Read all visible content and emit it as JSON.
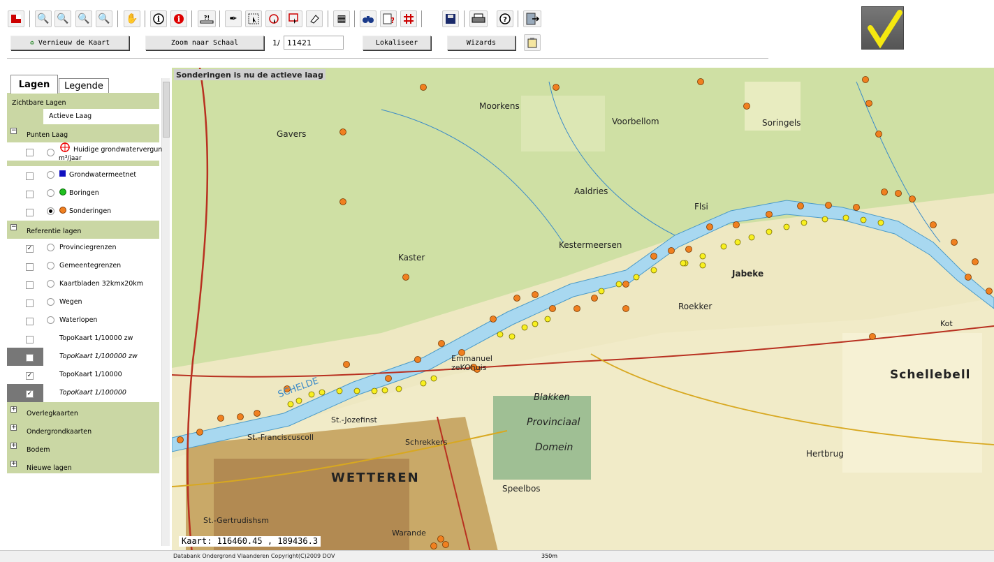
{
  "toolbar": {
    "icons": [
      "map-icon",
      "zoom-in-icon",
      "zoom-out-icon",
      "zoom-extent-icon",
      "zoom-select-icon",
      "pan-hand-icon",
      "info-icon",
      "info-red-icon",
      "measure-icon",
      "select-tool-icon",
      "select-arrow-icon",
      "select-circle-icon",
      "select-box-icon",
      "eraser-icon",
      "calculator-icon",
      "binoculars-icon",
      "query-icon",
      "grid-icon",
      "save-icon",
      "print-icon",
      "help-icon",
      "exit-icon"
    ],
    "refresh_label": "Vernieuw de Kaart",
    "zoom_scale_label": "Zoom naar Schaal",
    "scale_prefix": "1/",
    "scale_value": "11421",
    "locate_label": "Lokaliseer",
    "wizards_label": "Wizards"
  },
  "sidebar": {
    "tabs": [
      "Lagen",
      "Legende"
    ],
    "visible_layers_title": "Zichtbare Lagen",
    "active_layer_label": "Actieve Laag",
    "groups": {
      "points": "Punten Laag",
      "reference": "Referentie lagen",
      "overlay": "Overlegkaarten",
      "subsurface": "Ondergrondkaarten",
      "soil": "Bodem",
      "new": "Nieuwe lagen"
    },
    "point_layers": [
      {
        "label": "Huidige grondwatervergun",
        "label2": "m³/jaar",
        "checked": false,
        "active": false,
        "symbol": "red-target"
      },
      {
        "label": "Grondwatermeetnet",
        "checked": false,
        "active": false,
        "symbol": "blue-square"
      },
      {
        "label": "Boringen",
        "checked": false,
        "active": false,
        "symbol": "green-circle"
      },
      {
        "label": "Sonderingen",
        "checked": false,
        "active": true,
        "symbol": "orange-circle"
      }
    ],
    "reference_layers": [
      {
        "label": "Provinciegrenzen",
        "checked": true
      },
      {
        "label": "Gemeentegrenzen",
        "checked": false
      },
      {
        "label": "Kaartbladen 32kmx20km",
        "checked": false
      },
      {
        "label": "Wegen",
        "checked": false
      },
      {
        "label": "Waterlopen",
        "checked": false
      },
      {
        "label": "TopoKaart 1/10000 zw",
        "checked": false
      },
      {
        "label": "TopoKaart 1/100000 zw",
        "checked": false
      },
      {
        "label": "TopoKaart 1/10000",
        "checked": true
      },
      {
        "label": "TopoKaart 1/100000",
        "checked": true
      }
    ]
  },
  "map": {
    "banner": "Sonderingen is nu de actieve laag",
    "coords": "Kaart: 116460.45 , 189436.3",
    "copyright": "Databank Ondergrond Vlaanderen Copyright(C)2009 DOV",
    "scale_bar": "350m",
    "place_labels": [
      "Moorkens",
      "Gavers",
      "Voorbellom",
      "Soringels",
      "Aaldries",
      "Flsi",
      "Kestermeersen",
      "Kaster",
      "Jabeke",
      "Roekker",
      "Schellebell",
      "Emmanuel zeKOhuis",
      "Blakken",
      "Provinciaal",
      "Domein",
      "WETTEREN",
      "Speelbos",
      "Hertbrug",
      "St.-Jozefinst",
      "St.-Franciscuscoll",
      "Schrekkers",
      "St.-Gertrudishsm",
      "Warande",
      "Kot",
      "SCHELDE"
    ],
    "colors": {
      "river": "#a8d8f0",
      "sonderingen": "#f08020",
      "yellow_points": "#f8f020",
      "roads": "#b83020"
    }
  }
}
